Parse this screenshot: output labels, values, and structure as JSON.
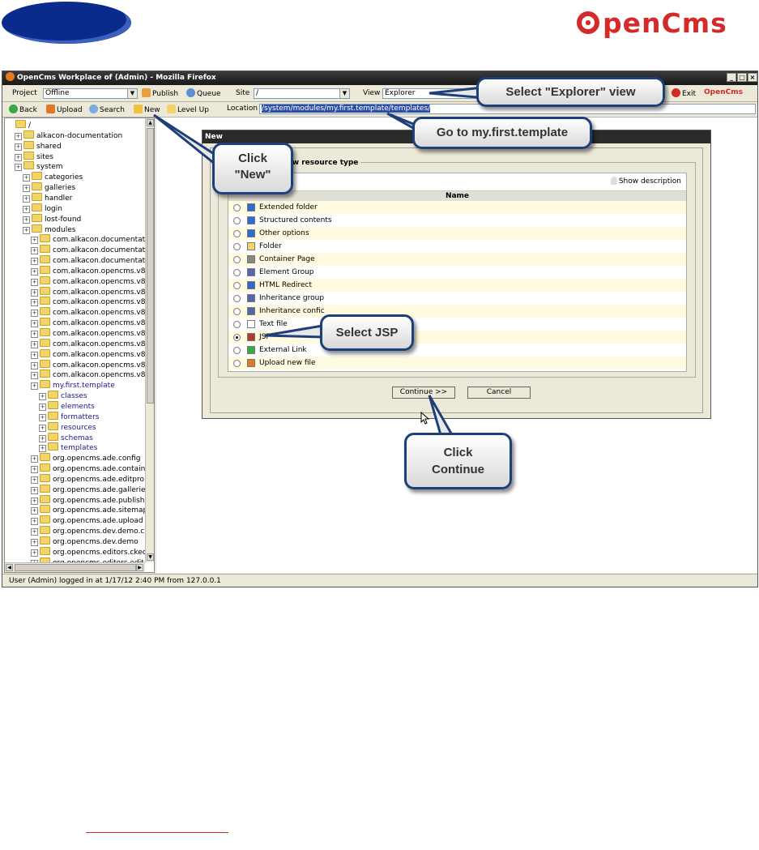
{
  "window": {
    "title": "OpenCms Workplace of (Admin) - Mozilla Firefox",
    "minimize_label": "_",
    "maximize_label": "□",
    "close_label": "×"
  },
  "logo": {
    "text": "penCms"
  },
  "toolbar1": {
    "project_label": "Project",
    "project_value": "Offline",
    "publish_label": "Publish",
    "queue_label": "Queue",
    "site_label": "Site",
    "site_value": "/",
    "view_label": "View",
    "view_value": "Explorer",
    "exit_label": "Exit",
    "brand_label": "OpenCms"
  },
  "toolbar2": {
    "back_label": "Back",
    "upload_label": "Upload",
    "search_label": "Search",
    "new_label": "New",
    "levelup_label": "Level Up",
    "location_label": "Location",
    "location_value": "/system/modules/my.first.template/templates/"
  },
  "tree": {
    "items": [
      {
        "label": "/",
        "indent": 0
      },
      {
        "label": "alkacon-documentation",
        "indent": 1
      },
      {
        "label": "shared",
        "indent": 1
      },
      {
        "label": "sites",
        "indent": 1
      },
      {
        "label": "system",
        "indent": 1
      },
      {
        "label": "categories",
        "indent": 2
      },
      {
        "label": "galleries",
        "indent": 2
      },
      {
        "label": "handler",
        "indent": 2
      },
      {
        "label": "login",
        "indent": 2
      },
      {
        "label": "lost-found",
        "indent": 2
      },
      {
        "label": "modules",
        "indent": 2
      },
      {
        "label": "com.alkacon.documentati",
        "indent": 3
      },
      {
        "label": "com.alkacon.documentati",
        "indent": 3
      },
      {
        "label": "com.alkacon.documentati",
        "indent": 3
      },
      {
        "label": "com.alkacon.opencms.v8",
        "indent": 3
      },
      {
        "label": "com.alkacon.opencms.v8",
        "indent": 3
      },
      {
        "label": "com.alkacon.opencms.v8",
        "indent": 3
      },
      {
        "label": "com.alkacon.opencms.v8",
        "indent": 3
      },
      {
        "label": "com.alkacon.opencms.v8",
        "indent": 3
      },
      {
        "label": "com.alkacon.opencms.v8",
        "indent": 3
      },
      {
        "label": "com.alkacon.opencms.v8",
        "indent": 3
      },
      {
        "label": "com.alkacon.opencms.v8",
        "indent": 3
      },
      {
        "label": "com.alkacon.opencms.v8",
        "indent": 3
      },
      {
        "label": "com.alkacon.opencms.v8",
        "indent": 3
      },
      {
        "label": "com.alkacon.opencms.v8",
        "indent": 3
      },
      {
        "label": "my.first.template",
        "indent": 3
      },
      {
        "label": "classes",
        "indent": 4
      },
      {
        "label": "elements",
        "indent": 4
      },
      {
        "label": "formatters",
        "indent": 4
      },
      {
        "label": "resources",
        "indent": 4
      },
      {
        "label": "schemas",
        "indent": 4
      },
      {
        "label": "templates",
        "indent": 4
      },
      {
        "label": "org.opencms.ade.config",
        "indent": 3
      },
      {
        "label": "org.opencms.ade.containe",
        "indent": 3
      },
      {
        "label": "org.opencms.ade.editpro",
        "indent": 3
      },
      {
        "label": "org.opencms.ade.gallerie",
        "indent": 3
      },
      {
        "label": "org.opencms.ade.publish",
        "indent": 3
      },
      {
        "label": "org.opencms.ade.sitemap",
        "indent": 3
      },
      {
        "label": "org.opencms.ade.upload",
        "indent": 3
      },
      {
        "label": "org.opencms.dev.demo.c",
        "indent": 3
      },
      {
        "label": "org.opencms.dev.demo",
        "indent": 3
      },
      {
        "label": "org.opencms.editors.ckec",
        "indent": 3
      },
      {
        "label": "org.opencms.editors.edit",
        "indent": 3
      }
    ]
  },
  "dialog": {
    "title": "New",
    "legend": "e new resource type",
    "show_description_label": "Show description",
    "column_name": "Name",
    "options": [
      {
        "label": "Extended folder",
        "selected": false,
        "icon": "double-chevron-icon"
      },
      {
        "label": "Structured contents",
        "selected": false,
        "icon": "double-chevron-icon"
      },
      {
        "label": "Other options",
        "selected": false,
        "icon": "double-chevron-icon"
      },
      {
        "label": "Folder",
        "selected": false,
        "icon": "folder-icon"
      },
      {
        "label": "Container Page",
        "selected": false,
        "icon": "container-page-icon"
      },
      {
        "label": "Element Group",
        "selected": false,
        "icon": "element-group-icon"
      },
      {
        "label": "HTML Redirect",
        "selected": false,
        "icon": "globe-icon"
      },
      {
        "label": "Inheritance group",
        "selected": false,
        "icon": "inheritance-icon"
      },
      {
        "label": "Inheritance confic",
        "selected": false,
        "icon": "inheritance-icon"
      },
      {
        "label": "Text file",
        "selected": false,
        "icon": "text-file-icon"
      },
      {
        "label": "JSP",
        "selected": true,
        "icon": "jsp-icon"
      },
      {
        "label": "External Link",
        "selected": false,
        "icon": "external-link-icon"
      },
      {
        "label": "Upload new file",
        "selected": false,
        "icon": "upload-icon"
      }
    ],
    "continue_label": "Continue >>",
    "cancel_label": "Cancel"
  },
  "statusbar": {
    "text": "User (Admin) logged in at 1/17/12 2:40 PM from 127.0.0.1"
  },
  "callouts": {
    "select_explorer": "Select \"Explorer\" view",
    "goto_template": "Go to my.first.template",
    "click_new_line1": "Click",
    "click_new_line2": "\"New\"",
    "select_jsp": "Select JSP",
    "click_continue_line1": "Click",
    "click_continue_line2": "Continue"
  },
  "colors": {
    "brand_red": "#d42a2a",
    "callout_border": "#1d3f7a",
    "dark_blue_oval": "#0a2a8c"
  }
}
